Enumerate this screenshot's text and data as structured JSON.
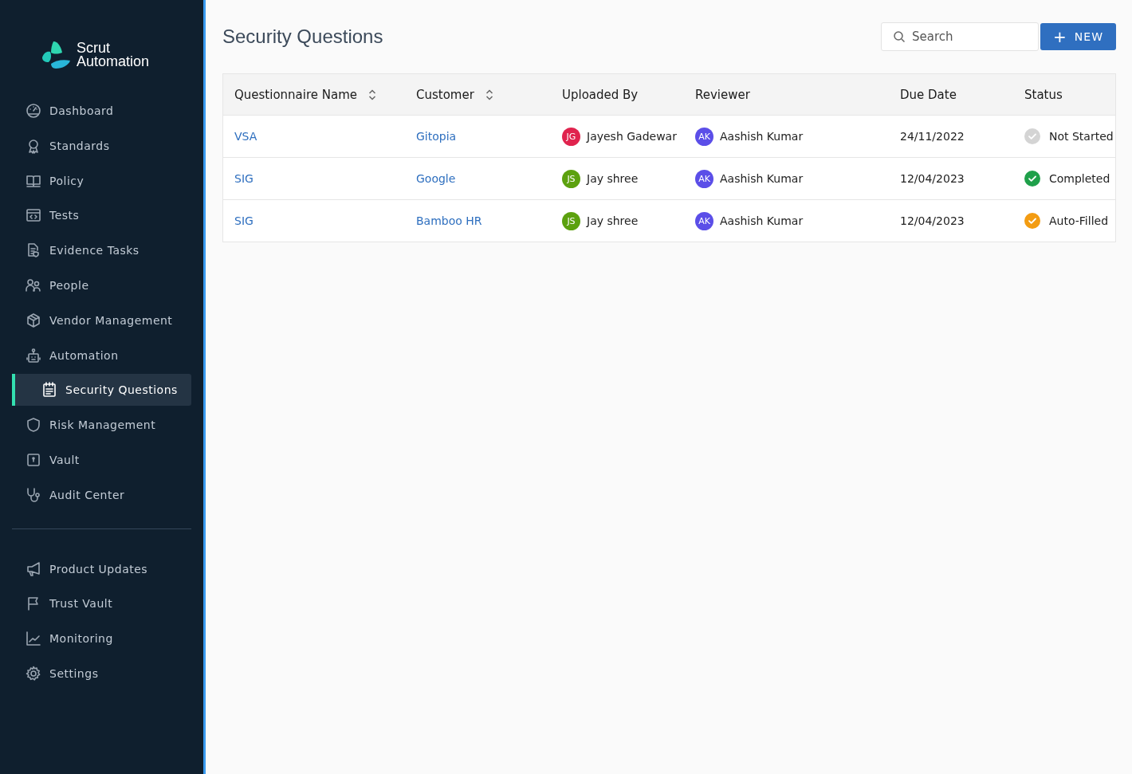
{
  "sidebar": {
    "logo": {
      "line1": "Scrut",
      "line2": "Automation"
    },
    "items": [
      {
        "label": "Dashboard",
        "selected": false
      },
      {
        "label": "Standards",
        "selected": false
      },
      {
        "label": "Policy",
        "selected": false
      },
      {
        "label": "Tests",
        "selected": false
      },
      {
        "label": "Evidence Tasks",
        "selected": false
      },
      {
        "label": "People",
        "selected": false
      },
      {
        "label": "Vendor Management",
        "selected": false
      },
      {
        "label": "Automation",
        "selected": false
      },
      {
        "label": "Security Questions",
        "selected": true
      },
      {
        "label": "Risk Management",
        "selected": false
      },
      {
        "label": "Vault",
        "selected": false
      },
      {
        "label": "Audit Center",
        "selected": false
      }
    ],
    "bottom_items": [
      {
        "label": "Product Updates",
        "selected": false
      },
      {
        "label": "Trust Vault",
        "selected": false
      },
      {
        "label": "Monitoring",
        "selected": false
      },
      {
        "label": "Settings",
        "selected": false
      }
    ]
  },
  "page": {
    "title": "Security Questions",
    "search": {
      "placeholder": "Search"
    },
    "new_button": {
      "icon": "+",
      "label": "NEW"
    }
  },
  "table": {
    "columns": [
      {
        "label": "Questionnaire Name",
        "sortable": true
      },
      {
        "label": "Customer",
        "sortable": true
      },
      {
        "label": "Uploaded By",
        "sortable": false
      },
      {
        "label": "Reviewer",
        "sortable": false
      },
      {
        "label": "Due Date",
        "sortable": false
      },
      {
        "label": "Status",
        "sortable": false
      }
    ],
    "rows": [
      {
        "name": "VSA",
        "customer": "Gitopia",
        "uploaded_by": {
          "initials": "JG",
          "name": "Jayesh Gadewar",
          "color": "#e0234e"
        },
        "reviewer": {
          "initials": "AK",
          "name": "Aashish Kumar",
          "color": "#5b4ee8"
        },
        "due_date": "24/11/2022",
        "status": {
          "kind": "not_started",
          "label": "Not Started"
        }
      },
      {
        "name": "SIG",
        "customer": "Google",
        "uploaded_by": {
          "initials": "JS",
          "name": "Jay shree",
          "color": "#5ca10f"
        },
        "reviewer": {
          "initials": "AK",
          "name": "Aashish Kumar",
          "color": "#5b4ee8"
        },
        "due_date": "12/04/2023",
        "status": {
          "kind": "completed",
          "label": "Completed"
        }
      },
      {
        "name": "SIG",
        "customer": "Bamboo HR",
        "uploaded_by": {
          "initials": "JS",
          "name": "Jay shree",
          "color": "#5ca10f"
        },
        "reviewer": {
          "initials": "AK",
          "name": "Aashish Kumar",
          "color": "#5b4ee8"
        },
        "due_date": "12/04/2023",
        "status": {
          "kind": "auto_filled",
          "label": "Auto-Filled"
        }
      }
    ]
  }
}
